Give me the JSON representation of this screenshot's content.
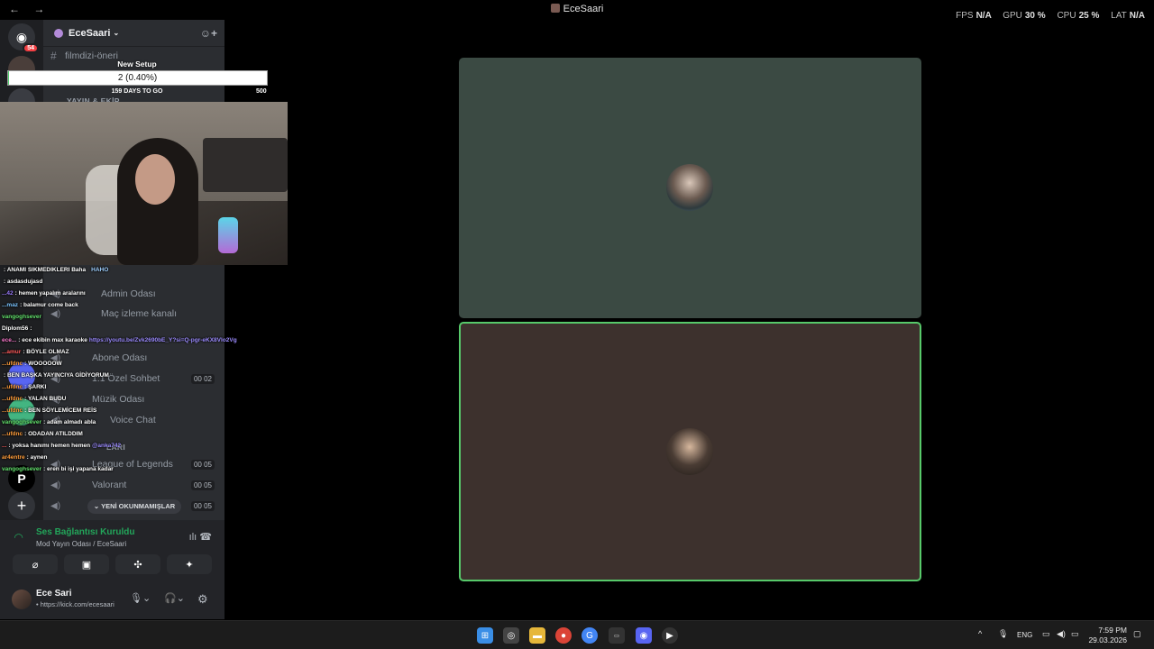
{
  "window": {
    "title": "EceSaari",
    "back": "←",
    "forward": "→"
  },
  "stats": {
    "fps_label": "FPS",
    "fps_value": "N/A",
    "gpu_label": "GPU",
    "gpu_value": "30 %",
    "cpu_label": "CPU",
    "cpu_value": "25 %",
    "lat_label": "LAT",
    "lat_value": "N/A"
  },
  "rail": {
    "home_badge": "54",
    "add_server": "+",
    "p_server": "P"
  },
  "server": {
    "name": "EceSaari",
    "channels_top": [
      {
        "label": "filmdizi-öneri"
      }
    ],
    "category_yayin": "YAYIN & EKİP",
    "voice_channels": [
      {
        "label": "Admin Odası"
      },
      {
        "label": "Maç izleme kanalı"
      },
      {
        "label": "Abone Odası"
      },
      {
        "label": "1:1 Özel Sohbet",
        "count": "00 02"
      },
      {
        "label": "Müzik Odası"
      },
      {
        "label": "Voice Chat"
      }
    ],
    "category_oyun": "LARI",
    "game_channels": [
      {
        "label": "League of Legends",
        "count": "00 05"
      },
      {
        "label": "Valorant",
        "count": "00 05"
      },
      {
        "label": "",
        "count": "00 05"
      }
    ],
    "new_unread": "YENİ OKUNMAMIŞLAR"
  },
  "voice_panel": {
    "status": "Ses Bağlantısı Kuruldu",
    "channel": "Mod Yayın Odası / EceSaari"
  },
  "user": {
    "name": "Ece Sari",
    "status": "• https://kick.com/ecesaari"
  },
  "goal": {
    "title": "New Setup",
    "progress_text": "2 (0.40%)",
    "progress_fraction": 0.004,
    "days": "159 DAYS TO GO",
    "max": "500"
  },
  "chat": [
    {
      "user": "",
      "text": ": ANAMI SIKMEDIKLERI Baha",
      "extra": "HAHO",
      "color": "#ff5b5b"
    },
    {
      "user": "",
      "text": ": asdasdujasd",
      "color": "#ff5b5b"
    },
    {
      "user": "...42",
      "text": ": hemen yapalım aralarını",
      "color": "#9b7bff"
    },
    {
      "user": "...maz",
      "text": ": balamur come back",
      "color": "#7bc4ff"
    },
    {
      "user": "vangoghsever",
      "text": "",
      "color": "#62e06c"
    },
    {
      "user": "Diplom56",
      "text": ":",
      "color": "#ffffff"
    },
    {
      "user": "ece...",
      "text": ": ece ekibin max karaoke",
      "link": "https://youtu.be/Zvk2690bE_Y?si=Q-pgr-eKX8Vlo2Vg",
      "color": "#ff7bd0"
    },
    {
      "user": "...amur",
      "text": ": BÖYLE OLMAZ",
      "color": "#ff5b5b"
    },
    {
      "user": "...ufdnc",
      "text": ": WOOOOOW",
      "color": "#ff9d3b"
    },
    {
      "user": "",
      "text": ": BEN BAŞKA YAYINCIYA GİDİYORUM",
      "color": "#ff5b5b"
    },
    {
      "user": "...ufdnc",
      "text": ": ŞARKI",
      "color": "#ff9d3b"
    },
    {
      "user": "...ufdnc",
      "text": ": YALAN BUDU",
      "color": "#ff9d3b"
    },
    {
      "user": "...ufdnc",
      "text": ": BEN SÖYLEMİCEM REİS",
      "color": "#ff9d3b"
    },
    {
      "user": "vangoghsever",
      "text": ": adam almadı abla",
      "color": "#62e06c"
    },
    {
      "user": "...ufdnc",
      "text": ": ODADAN ATILDDIM",
      "color": "#ff9d3b"
    },
    {
      "user": "...",
      "text": ": yoksa hanımı hemen hemen",
      "link": "@anka742",
      "color": "#ff5b5b"
    },
    {
      "user": "ar4entre",
      "text": ": aynen",
      "color": "#ff9d3b"
    },
    {
      "user": "vangoghsever",
      "text": ": eren bi işi yapana kadar",
      "color": "#62e06c"
    }
  ],
  "taskbar": {
    "lang": "ENG",
    "time": "7:59 PM",
    "date": "29.03.2026"
  },
  "colors": {
    "accent_green": "#57c96a",
    "discord_red": "#f23f43"
  }
}
